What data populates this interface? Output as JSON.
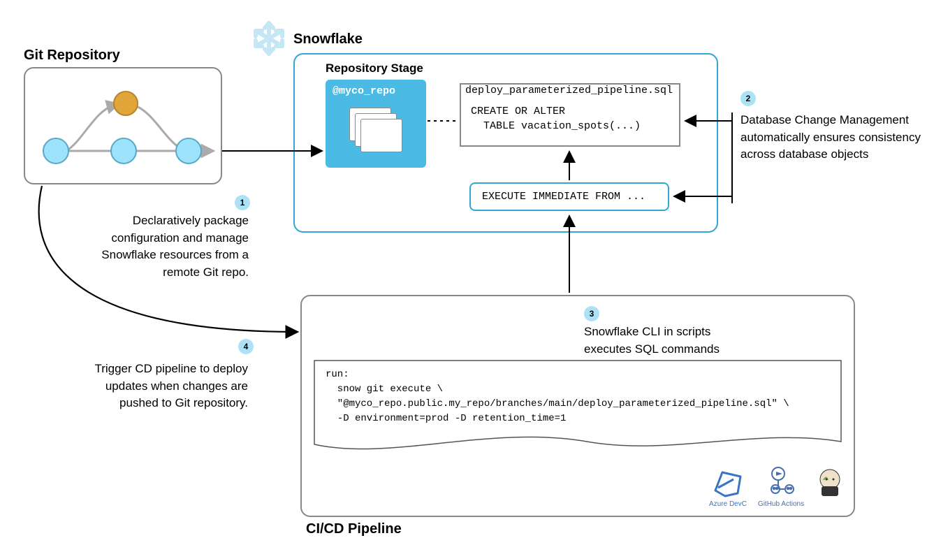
{
  "git": {
    "title": "Git Repository"
  },
  "snowflake": {
    "title": "Snowflake",
    "repo_stage_title": "Repository Stage",
    "repo_stage_name": "@myco_repo",
    "deploy_file_name": "deploy_parameterized_pipeline.sql",
    "deploy_file_body": "CREATE OR ALTER\n  TABLE vacation_spots(...)",
    "execute_immediate": "EXECUTE IMMEDIATE FROM ..."
  },
  "cicd": {
    "title": "CI/CD Pipeline",
    "script": "run:\n  snow git execute \\\n  \"@myco_repo.public.my_repo/branches/main/deploy_parameterized_pipeline.sql\" \\\n  -D environment=prod -D retention_time=1",
    "tools": {
      "azure": "Azure DevC",
      "gha": "GitHub Actions",
      "jenkins": ""
    }
  },
  "annotations": {
    "n1": "Declaratively package configuration and manage Snowflake resources from a remote Git repo.",
    "n2": "Database Change Management automatically ensures consistency across database objects",
    "n3": "Snowflake CLI in scripts executes SQL commands",
    "n4": "Trigger CD pipeline to deploy updates when changes are pushed to Git repository."
  },
  "badges": {
    "b1": "1",
    "b2": "2",
    "b3": "3",
    "b4": "4"
  }
}
